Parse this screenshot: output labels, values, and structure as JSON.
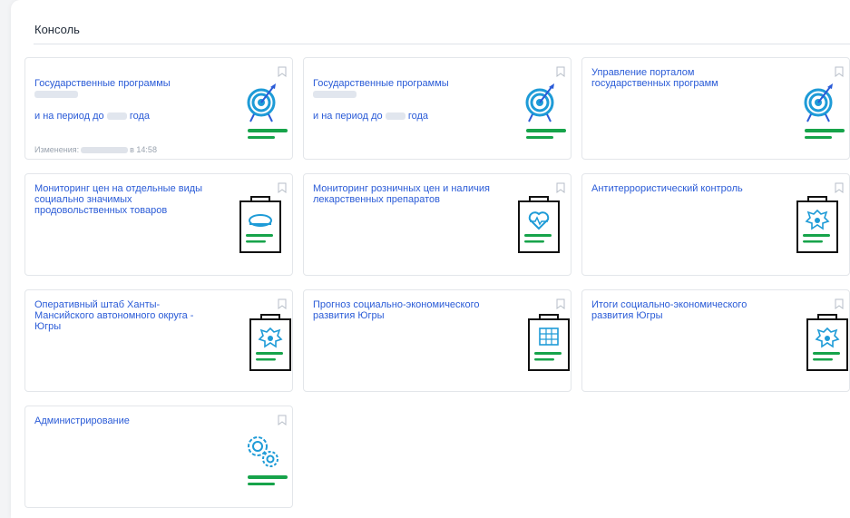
{
  "console": {
    "title": "Консоль"
  },
  "cards": [
    {
      "title": "Государственные программы",
      "title2": "и на период до",
      "title2b": "года",
      "meta_prefix": "Изменения:",
      "meta_suffix": "в 14:58"
    },
    {
      "title": "Государственные программы",
      "title2": "и на период до",
      "title2b": "года"
    },
    {
      "title": "Управление порталом государственных программ"
    },
    {
      "title": "Мониторинг цен на отдельные виды социально значимых продовольственных товаров"
    },
    {
      "title": "Мониторинг розничных цен и наличия лекарственных препаратов"
    },
    {
      "title": "Антитеррористический контроль"
    },
    {
      "title": "Оперативный штаб Ханты-Мансийского автономного округа - Югры"
    },
    {
      "title": "Прогноз социально-экономического развития Югры"
    },
    {
      "title": "Итоги социально-экономического развития Югры"
    },
    {
      "title": "Администрирование"
    }
  ],
  "icons": [
    "target-icon",
    "target-icon",
    "target-icon",
    "clipboard-bread-icon",
    "clipboard-heart-icon",
    "clipboard-emblem-icon",
    "clipboard-emblem-icon",
    "clipboard-grid-icon",
    "clipboard-emblem-icon",
    "gears-icon"
  ],
  "colors": {
    "link": "#2a5bd7",
    "accent_blue": "#1e9bd7",
    "accent_green": "#16a34a",
    "border": "#e3e6ea"
  }
}
